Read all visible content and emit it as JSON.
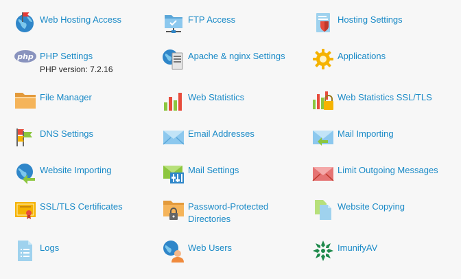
{
  "tools": {
    "web_hosting_access": "Web Hosting Access",
    "ftp_access": "FTP Access",
    "hosting_settings": "Hosting Settings",
    "php_settings": "PHP Settings",
    "php_version": "PHP version: 7.2.16",
    "php_icon_text": "php",
    "apache_nginx_settings": "Apache & nginx Settings",
    "applications": "Applications",
    "file_manager": "File Manager",
    "web_statistics": "Web Statistics",
    "web_statistics_ssl": "Web Statistics SSL/TLS",
    "dns_settings": "DNS Settings",
    "email_addresses": "Email Addresses",
    "mail_importing": "Mail Importing",
    "website_importing": "Website Importing",
    "mail_settings": "Mail Settings",
    "limit_outgoing_messages": "Limit Outgoing Messages",
    "ssl_tls_certificates": "SSL/TLS Certificates",
    "password_protected_directories_line1": "Password-Protected",
    "password_protected_directories_line2": "Directories",
    "website_copying": "Website Copying",
    "logs": "Logs",
    "web_users": "Web Users",
    "imunifyav": "ImunifyAV"
  },
  "colors": {
    "link": "#1a8ac7",
    "text": "#222222",
    "background": "#f7f7f7"
  },
  "icons": {
    "web_hosting_access": "globe-flag-icon",
    "ftp_access": "folder-network-icon",
    "hosting_settings": "document-shield-icon",
    "php_settings": "php-logo-icon",
    "apache_nginx_settings": "server-globe-icon",
    "applications": "gear-icon",
    "file_manager": "folder-icon",
    "web_statistics": "bar-chart-icon",
    "web_statistics_ssl": "bar-chart-lock-icon",
    "dns_settings": "flags-icon",
    "email_addresses": "envelope-icon",
    "mail_importing": "envelope-arrow-icon",
    "website_importing": "globe-arrow-icon",
    "mail_settings": "envelope-sliders-icon",
    "limit_outgoing_messages": "envelope-red-icon",
    "ssl_tls_certificates": "certificate-icon",
    "password_protected_directories": "folder-lock-icon",
    "website_copying": "documents-copy-icon",
    "logs": "log-document-icon",
    "web_users": "globe-user-icon",
    "imunifyav": "imunify-star-icon"
  }
}
